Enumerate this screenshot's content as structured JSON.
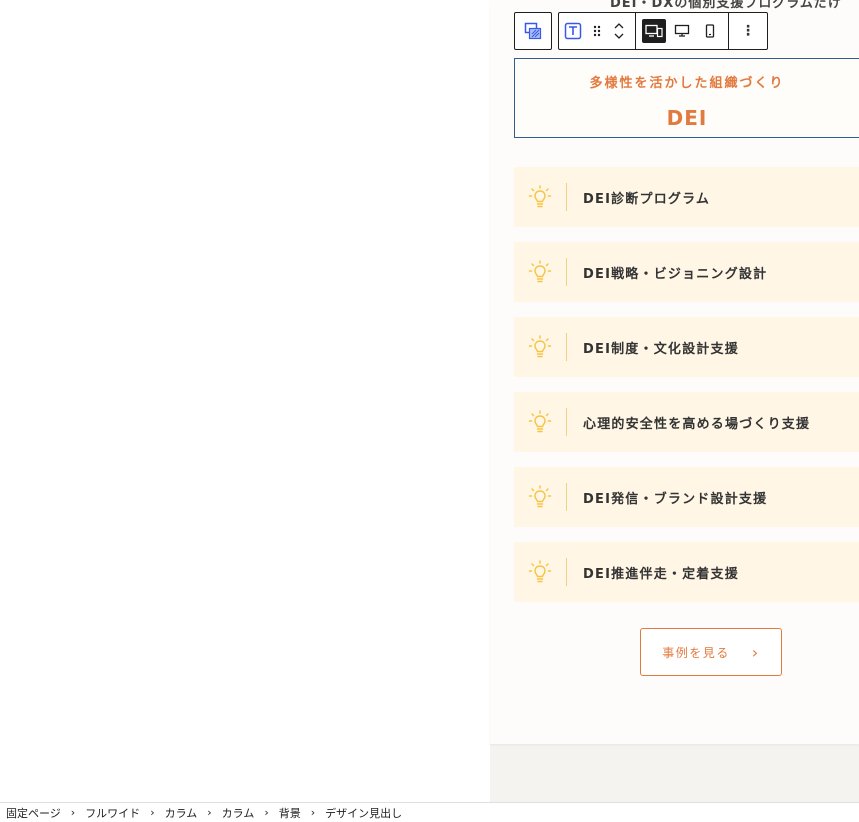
{
  "top_partial_text": "DEI・DXの個別支援プログラムだけ",
  "heading": {
    "subtitle": "多様性を活かした組織づくり",
    "title": "DEI"
  },
  "programs": [
    {
      "label": "DEI診断プログラム"
    },
    {
      "label": "DEI戦略・ビジョニング設計"
    },
    {
      "label": "DEI制度・文化設計支援"
    },
    {
      "label": "心理的安全性を高める場づくり支援"
    },
    {
      "label": "DEI発信・ブランド設計支援"
    },
    {
      "label": "DEI推進伴走・定着支援"
    }
  ],
  "cta": {
    "label": "事例を見る",
    "arrow": "›"
  },
  "breadcrumb": [
    "固定ページ",
    "フルワイド",
    "カラム",
    "カラム",
    "背景",
    "デザイン見出し"
  ],
  "breadcrumb_separator": "›",
  "toolbar": {
    "more_label": "⋮",
    "icons": [
      "parent-block-icon",
      "heading-block-icon",
      "drag-handle-icon",
      "move-up-icon",
      "move-down-icon",
      "all-devices-icon",
      "desktop-icon",
      "mobile-icon",
      "more-options-icon"
    ]
  },
  "colors": {
    "accent": "#e27a3f",
    "item_background": "#fff6e6",
    "icon_yellow": "#f6c547",
    "selection_border": "#2f5f8a"
  }
}
